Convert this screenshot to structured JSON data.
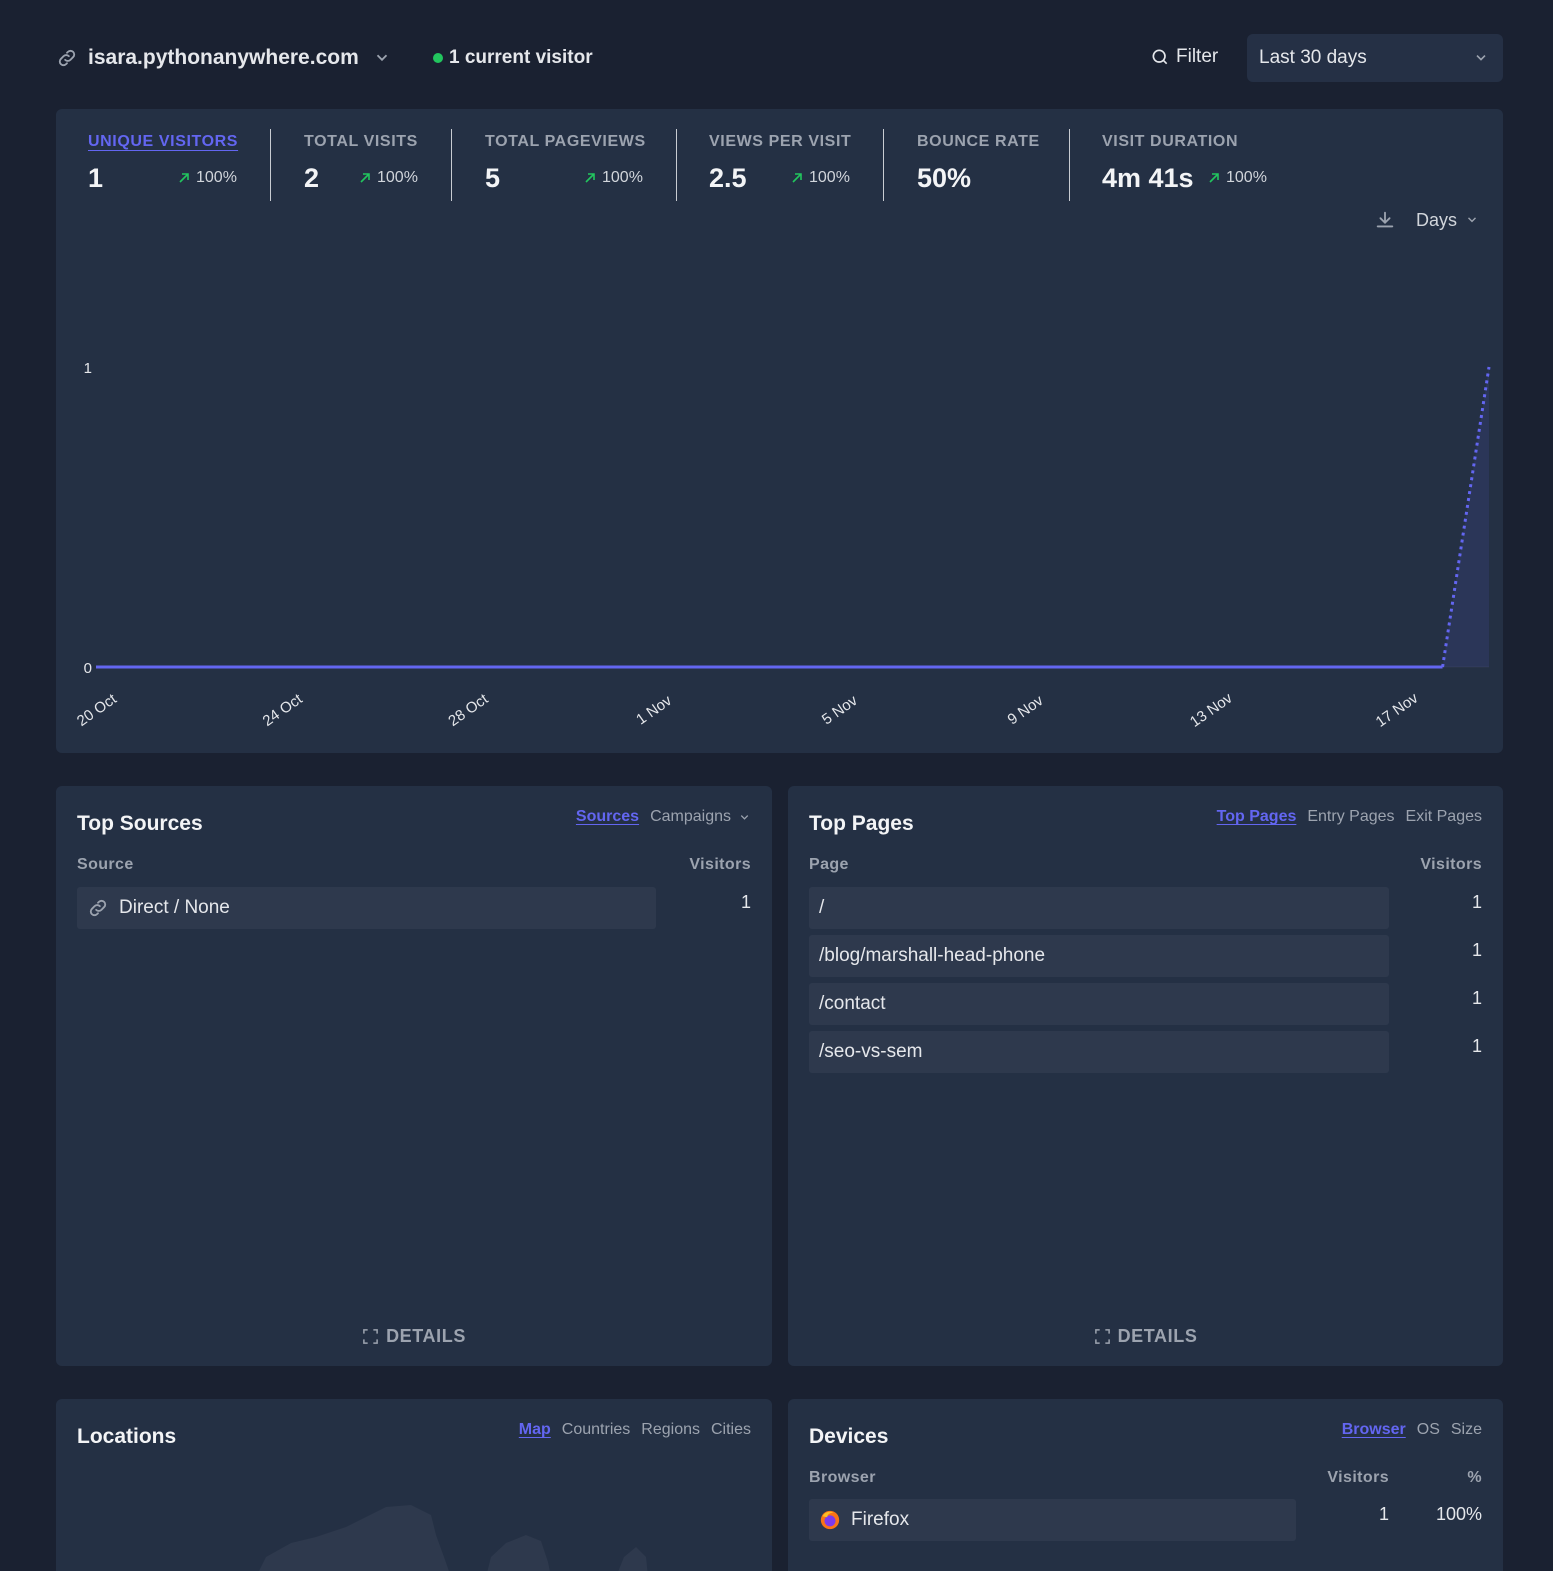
{
  "header": {
    "site": "isara.pythonanywhere.com",
    "current_visitors": "1 current visitor",
    "filter_label": "Filter",
    "period": "Last 30 days"
  },
  "stats": [
    {
      "label": "UNIQUE VISITORS",
      "value": "1",
      "change": "100%"
    },
    {
      "label": "TOTAL VISITS",
      "value": "2",
      "change": "100%"
    },
    {
      "label": "TOTAL PAGEVIEWS",
      "value": "5",
      "change": "100%"
    },
    {
      "label": "VIEWS PER VISIT",
      "value": "2.5",
      "change": "100%"
    },
    {
      "label": "BOUNCE RATE",
      "value": "50%",
      "change": ""
    },
    {
      "label": "VISIT DURATION",
      "value": "4m 41s",
      "change": "100%"
    }
  ],
  "chart_controls": {
    "interval": "Days"
  },
  "chart_data": {
    "type": "line",
    "x": [
      "20 Oct",
      "21 Oct",
      "22 Oct",
      "23 Oct",
      "24 Oct",
      "25 Oct",
      "26 Oct",
      "27 Oct",
      "28 Oct",
      "29 Oct",
      "30 Oct",
      "31 Oct",
      "1 Nov",
      "2 Nov",
      "3 Nov",
      "4 Nov",
      "5 Nov",
      "6 Nov",
      "7 Nov",
      "8 Nov",
      "9 Nov",
      "10 Nov",
      "11 Nov",
      "12 Nov",
      "13 Nov",
      "14 Nov",
      "15 Nov",
      "16 Nov",
      "17 Nov",
      "18 Nov",
      "19 Nov"
    ],
    "series": [
      {
        "values": [
          0,
          0,
          0,
          0,
          0,
          0,
          0,
          0,
          0,
          0,
          0,
          0,
          0,
          0,
          0,
          0,
          0,
          0,
          0,
          0,
          0,
          0,
          0,
          0,
          0,
          0,
          0,
          0,
          0,
          0,
          1
        ]
      }
    ],
    "x_tick_labels": [
      "20 Oct",
      "24 Oct",
      "28 Oct",
      "1 Nov",
      "5 Nov",
      "9 Nov",
      "13 Nov",
      "17 Nov"
    ],
    "y_tick_labels": [
      "0",
      "1"
    ],
    "ylim": [
      0,
      1
    ],
    "color": "#6366f1",
    "partial_last_segment": "dotted"
  },
  "top_sources": {
    "title": "Top Sources",
    "tabs": {
      "sources": "Sources",
      "campaigns": "Campaigns"
    },
    "col_source": "Source",
    "col_visitors": "Visitors",
    "rows": [
      {
        "label": "Direct / None",
        "visitors": "1"
      }
    ],
    "details": "DETAILS"
  },
  "top_pages": {
    "title": "Top Pages",
    "tabs": {
      "top": "Top Pages",
      "entry": "Entry Pages",
      "exit": "Exit Pages"
    },
    "col_page": "Page",
    "col_visitors": "Visitors",
    "rows": [
      {
        "label": "/",
        "visitors": "1"
      },
      {
        "label": "/blog/marshall-head-phone",
        "visitors": "1"
      },
      {
        "label": "/contact",
        "visitors": "1"
      },
      {
        "label": "/seo-vs-sem",
        "visitors": "1"
      }
    ],
    "details": "DETAILS"
  },
  "locations": {
    "title": "Locations",
    "tabs": {
      "map": "Map",
      "countries": "Countries",
      "regions": "Regions",
      "cities": "Cities"
    }
  },
  "devices": {
    "title": "Devices",
    "tabs": {
      "browser": "Browser",
      "os": "OS",
      "size": "Size"
    },
    "col_browser": "Browser",
    "col_visitors": "Visitors",
    "col_pct": "%",
    "rows": [
      {
        "label": "Firefox",
        "visitors": "1",
        "pct": "100%"
      }
    ]
  }
}
